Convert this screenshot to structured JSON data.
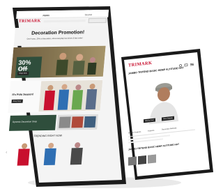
{
  "tablet": {
    "nav": {
      "logo": "TRIMARK",
      "center_logo": "PERRI",
      "right_logo": "Stockist"
    },
    "promo": {
      "title": "Decoration Promotion!",
      "subtitle": "Get Promo, 20% of decoration, all at everyday low prices & fast order!"
    },
    "hero": {
      "percent": "30% Off",
      "sub": "All Apparel",
      "button": "Shop Now"
    },
    "polo": {
      "title": "It's Polo Season!",
      "button": "Shop Now"
    },
    "green_tag": "Dynamic Decoration Shop",
    "trending_title": "TRENDING RIGHT NOW",
    "carousel_arrow": "‹"
  },
  "phone": {
    "logo": "TRIMARK",
    "product_title": "JAMBO TRITEND BASIC HEMP ALTITUDE HAT",
    "thumb_buttons": [
      "Add to Cart",
      "View Details"
    ],
    "tabs": [
      "Product Features",
      "Features",
      "Decoration Methods"
    ],
    "bottom_title": "JAMBO TRITEND BASIC HEMP ALTITUDE HAT"
  },
  "colors": {
    "brand_red": "#c8102e",
    "dark_green": "#2f4e3c",
    "device_black": "#1a1a1a"
  }
}
